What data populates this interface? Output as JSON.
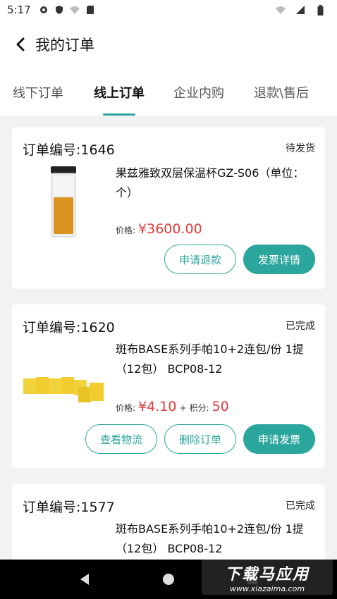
{
  "status_bar": {
    "time": "5:17"
  },
  "header": {
    "title": "我的订单"
  },
  "tabs": [
    {
      "label": "线下订单"
    },
    {
      "label": "线上订单"
    },
    {
      "label": "企业内购"
    },
    {
      "label": "退款\\售后"
    }
  ],
  "orders": [
    {
      "order_no": "订单编号:1646",
      "status": "待发货",
      "product_name": "果兹雅致双层保温杯GZ-S06（单位：个）",
      "price_label": "价格:",
      "price": "¥3600.00",
      "buttons": [
        "申请退款",
        "发票详情"
      ]
    },
    {
      "order_no": "订单编号:1620",
      "status": "已完成",
      "product_name": "斑布BASE系列手帕10+2连包/份 1提（12包） BCP08-12",
      "price_label": "价格:",
      "price": "¥4.10",
      "plus": "+",
      "points_label": "积分:",
      "points": "50",
      "buttons": [
        "查看物流",
        "删除订单",
        "申请发票"
      ]
    },
    {
      "order_no": "订单编号:1577",
      "status": "已完成",
      "product_name": "斑布BASE系列手帕10+2连包/份 1提（12包） BCP08-12"
    }
  ],
  "watermark": {
    "line1": "下载马应用",
    "line2": "www.xiazaima.com"
  },
  "colors": {
    "accent": "#2ba69d",
    "price": "#e4393c"
  }
}
